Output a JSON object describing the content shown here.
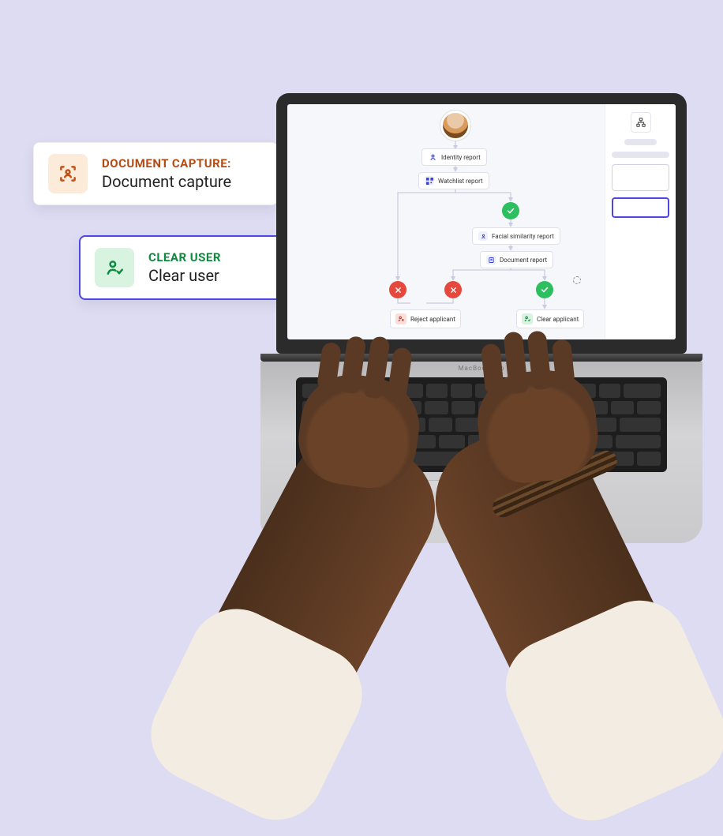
{
  "callouts": {
    "document_capture": {
      "title": "DOCUMENT CAPTURE:",
      "sub": "Document capture"
    },
    "clear_user": {
      "title": "CLEAR USER",
      "sub": "Clear user"
    }
  },
  "flow": {
    "identity_report": "Identity report",
    "watchlist_report": "Watchlist report",
    "facial_similarity_report": "Facial similarity report",
    "document_report": "Document report",
    "reject_applicant": "Reject applicant",
    "clear_applicant": "Clear applicant"
  },
  "laptop": {
    "brand": "MacBook Pro"
  },
  "colors": {
    "accent": "#4F46E5",
    "success": "#2DBE60",
    "danger": "#E5493D",
    "orange": "#C2521A"
  }
}
